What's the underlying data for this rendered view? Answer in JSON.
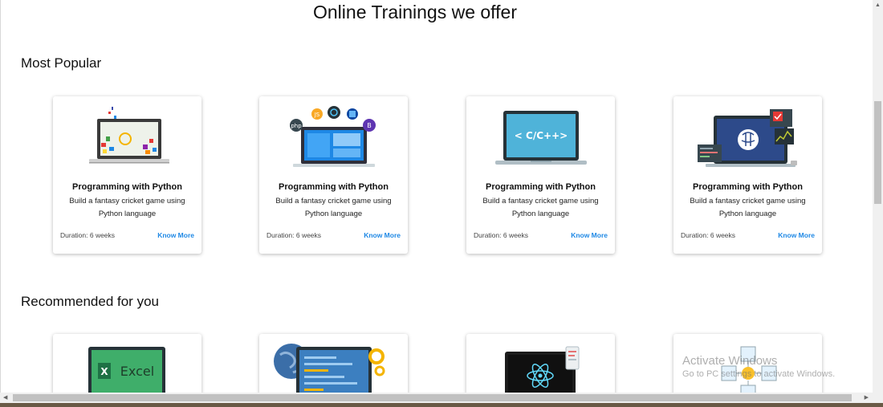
{
  "page": {
    "title": "Online Trainings we offer"
  },
  "sections": {
    "popular": {
      "title": "Most Popular"
    },
    "recommended": {
      "title": "Recommended for you"
    }
  },
  "popular_cards": [
    {
      "art": "python-laptop-illustration",
      "title": "Programming with Python",
      "desc": "Build a fantasy cricket game using Python language",
      "duration": "Duration: 6 weeks",
      "link": "Know More"
    },
    {
      "art": "web-tech-laptop-illustration",
      "title": "Programming with Python",
      "desc": "Build a fantasy cricket game using Python language",
      "duration": "Duration: 6 weeks",
      "link": "Know More",
      "badges": [
        "php",
        "JS",
        "B"
      ]
    },
    {
      "art": "c-cpp-laptop-illustration",
      "title": "Programming with Python",
      "desc": "Build a fantasy cricket game using Python language",
      "duration": "Duration: 6 weeks",
      "link": "Know More",
      "screen_text": "< C/C++>"
    },
    {
      "art": "machine-learning-brain-illustration",
      "title": "Programming with Python",
      "desc": "Build a fantasy cricket game using Python language",
      "duration": "Duration: 6 weeks",
      "link": "Know More"
    }
  ],
  "recommended_cards": [
    {
      "art": "excel-laptop-illustration",
      "label": "Excel"
    },
    {
      "art": "coding-globe-illustration"
    },
    {
      "art": "react-laptop-illustration"
    },
    {
      "art": "blockchain-cubes-illustration"
    }
  ],
  "watermark": {
    "line1": "Activate Windows",
    "line2": "Go to PC settings to activate Windows."
  },
  "colors": {
    "link": "#1e88e5",
    "excel_green": "#1e7145",
    "laptop_screen_blue": "#2d4a8a"
  }
}
